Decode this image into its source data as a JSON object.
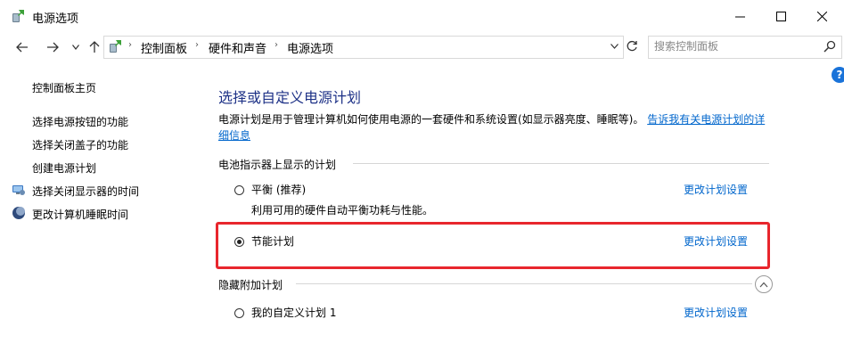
{
  "window": {
    "title": "电源选项"
  },
  "address_bar": {
    "breadcrumbs": [
      "控制面板",
      "硬件和声音",
      "电源选项"
    ]
  },
  "search": {
    "placeholder": "搜索控制面板"
  },
  "sidebar": {
    "home": "控制面板主页",
    "items": [
      {
        "label": "选择电源按钮的功能"
      },
      {
        "label": "选择关闭盖子的功能"
      },
      {
        "label": "创建电源计划"
      },
      {
        "label": "选择关闭显示器的时间",
        "icon": "monitor-icon"
      },
      {
        "label": "更改计算机睡眠时间",
        "icon": "moon-icon"
      }
    ]
  },
  "main": {
    "title": "选择或自定义电源计划",
    "description": "电源计划是用于管理计算机如何使用电源的一套硬件和系统设置(如显示器亮度、睡眠等)。",
    "description_link": "告诉我有关电源计划的详细信息",
    "battery_section_label": "电池指示器上显示的计划",
    "hidden_section_label": "隐藏附加计划",
    "plans": [
      {
        "name": "平衡 (推荐)",
        "description": "利用可用的硬件自动平衡功耗与性能。",
        "selected": false,
        "change_label": "更改计划设置"
      },
      {
        "name": "节能计划",
        "description": "",
        "selected": true,
        "change_label": "更改计划设置"
      },
      {
        "name": "我的自定义计划 1",
        "description": "",
        "selected": false,
        "change_label": "更改计划设置"
      }
    ]
  },
  "colors": {
    "title": "#1e3287",
    "link": "#0066cc",
    "highlight": "#e8262d"
  }
}
